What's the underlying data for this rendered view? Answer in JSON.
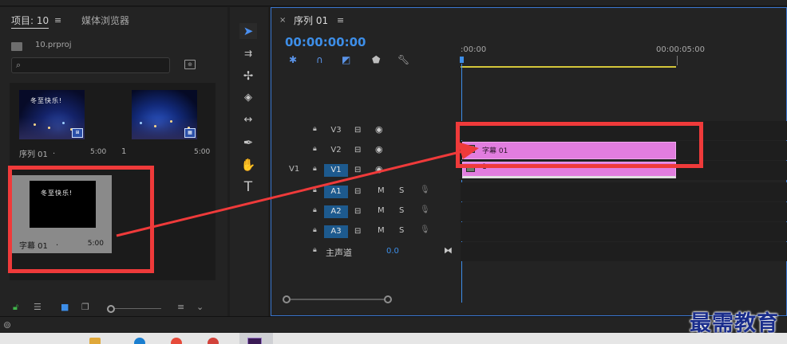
{
  "top": {
    "timecode": "00:00:00:00"
  },
  "project": {
    "tab_project": "项目: 10",
    "tab_menu": "≡",
    "tab_media": "媒体浏览器",
    "file_name": "10.prproj",
    "items": [
      {
        "name": "序列 01",
        "dot": ".",
        "duration": "5:00",
        "caption": "冬至快乐!"
      },
      {
        "name": "1",
        "dot": "",
        "duration": "5:00"
      },
      {
        "name": "字幕 01",
        "dot": ".",
        "duration": "5:00",
        "caption": "冬至快乐!"
      }
    ]
  },
  "timeline": {
    "sequence_tab": "序列 01",
    "close": "×",
    "menu": "≡",
    "timecode": "00:00:00:00",
    "ruler_start": ":00:00",
    "ruler_end": "00:00:05:00",
    "video_tracks": [
      {
        "name": "V3",
        "source": "",
        "on": false
      },
      {
        "name": "V2",
        "source": "",
        "on": false
      },
      {
        "name": "V1",
        "source": "V1",
        "on": true
      }
    ],
    "audio_tracks": [
      {
        "name": "A1",
        "source": "",
        "m": "M",
        "s": "S"
      },
      {
        "name": "A2",
        "source": "",
        "m": "M",
        "s": "S"
      },
      {
        "name": "A3",
        "source": "",
        "m": "M",
        "s": "S"
      }
    ],
    "master_label": "主声道",
    "master_value": "0.0",
    "clips": {
      "title_clip": "字幕 01",
      "video_clip": "1"
    }
  },
  "colors": {
    "accent": "#3d8ee8",
    "clip": "#e27ddf",
    "annotation": "#ef3a3a"
  },
  "watermark": "最需教育"
}
